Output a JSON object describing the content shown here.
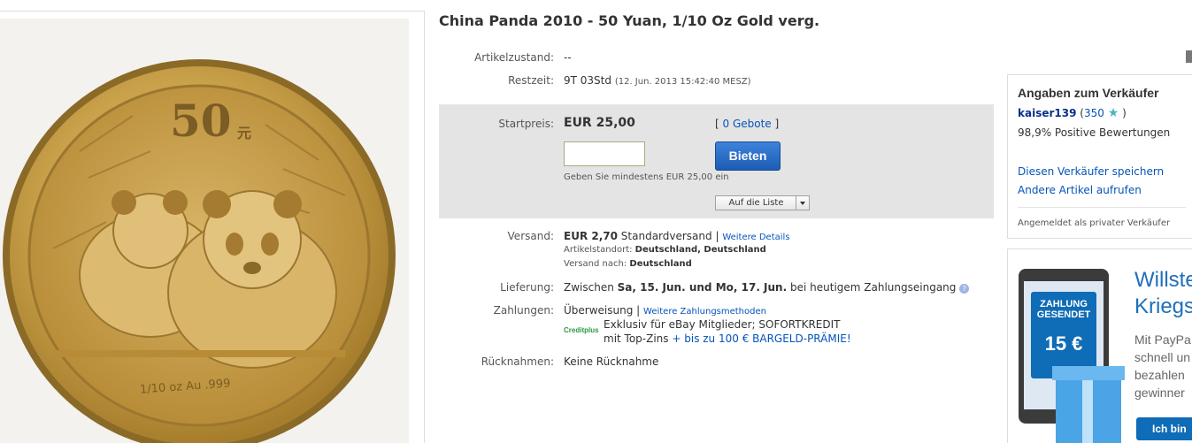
{
  "listing": {
    "title": "China Panda 2010 - 50 Yuan, 1/10 Oz Gold verg."
  },
  "coin_image": {
    "denomination": "50",
    "denomination_suffix": "元",
    "inscription": "1/10 oz Au .999",
    "colors": {
      "gold": "#c9a14a",
      "rim": "#b88c37"
    }
  },
  "details": {
    "condition": {
      "label": "Artikelzustand:",
      "value": "--"
    },
    "time_left": {
      "label": "Restzeit:",
      "value": "9T 03Std",
      "end": "(12. Jun. 2013  15:42:40 MESZ)"
    }
  },
  "bid": {
    "start_label": "Startpreis:",
    "start_price": "EUR 25,00",
    "bids_open": "[",
    "bids_link": "0 Gebote",
    "bids_close": "]",
    "input_value": "",
    "button_label": "Bieten",
    "hint": "Geben Sie mindestens EUR 25,00 ein",
    "watch_label": "Auf die Liste"
  },
  "shipping": {
    "label": "Versand:",
    "price": "EUR 2,70",
    "service": "Standardversand |",
    "details_link": "Weitere Details",
    "location_label": "Artikelstandort:",
    "location": "Deutschland, Deutschland",
    "ships_to_label": "Versand nach:",
    "ships_to": "Deutschland"
  },
  "delivery": {
    "label": "Lieferung:",
    "prefix": "Zwischen",
    "range": "Sa, 15. Jun. und Mo, 17. Jun.",
    "suffix": "bei heutigem Zahlungseingang"
  },
  "payment": {
    "label": "Zahlungen:",
    "method": "Überweisung  |",
    "more_link": "Weitere Zahlungsmethoden",
    "creditplus_logo": "Creditplus",
    "offer_line1": "Exklusiv für eBay Mitglieder; SOFORTKREDIT",
    "offer_line2": "mit Top-Zins",
    "offer_link": "+ bis zu 100 € BARGELD-PRÄMIE!"
  },
  "returns": {
    "label": "Rücknahmen:",
    "value": "Keine Rücknahme"
  },
  "seller": {
    "heading": "Angaben zum Verkäufer",
    "name": "kaiser139",
    "feedback_open": "(",
    "feedback_score": "350",
    "feedback_close": ")",
    "positive": "98,9% Positive Bewertungen",
    "save_link": "Diesen Verkäufer speichern",
    "other_items_link": "Andere Artikel aufrufen",
    "seller_type": "Angemeldet als privater Verkäufer"
  },
  "ad": {
    "badge_line1": "ZAHLUNG",
    "badge_line2": "GESENDET",
    "badge_amount": "15 €",
    "headline_1": "Willste",
    "headline_2": "Kriegs",
    "body_1": "Mit PayPa",
    "body_2": "schnell un",
    "body_3": "bezahlen",
    "body_4": "gewinner",
    "button_label": "Ich bin"
  }
}
